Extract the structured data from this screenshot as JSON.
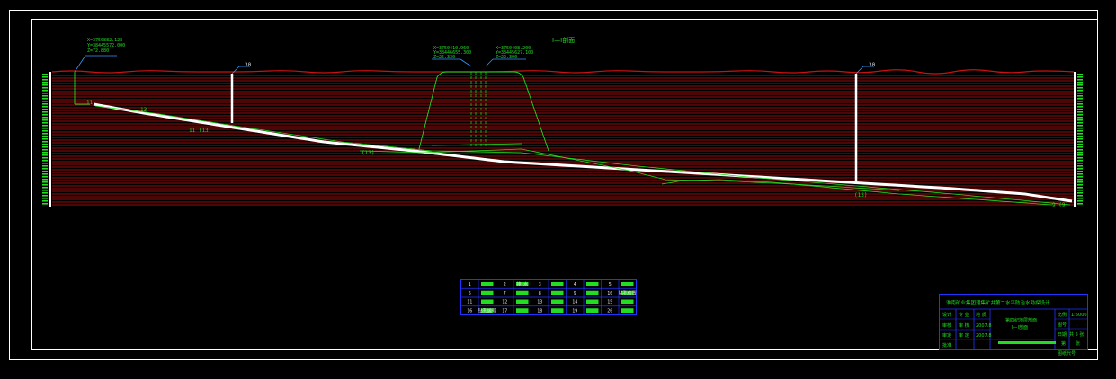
{
  "drawing": {
    "section_title": "I—I剖面",
    "markers": [
      {
        "label": "30"
      },
      {
        "label": "30"
      }
    ],
    "boreholes": [
      {
        "lines": [
          "X=3750882.128",
          "Y=38445572.000",
          "Z=72.880"
        ]
      },
      {
        "lines": [
          "X=3750410.960",
          "Y=38446655.300",
          "Z=25.330"
        ]
      },
      {
        "lines": [
          "X=3750408.200",
          "Y=38445627.100",
          "Z=22.300"
        ]
      }
    ],
    "seam_labels": [
      "11",
      "13",
      "11 (13)",
      "(13)",
      "(13)",
      "9 (9)"
    ],
    "colors": {
      "frame": "#ffffff",
      "strata": "#cc1111",
      "drawing": "#22dd22",
      "seam": "#ffffff",
      "table_border": "#2233ff"
    }
  },
  "legend_table": {
    "rows": [
      [
        "1",
        "",
        "2",
        "排 水",
        "3",
        "",
        "4",
        "",
        "5",
        ""
      ],
      [
        "6",
        "",
        "7",
        "",
        "8",
        "",
        "9",
        "",
        "10",
        "钻孔位置"
      ],
      [
        "11",
        "",
        "12",
        "",
        "13",
        "",
        "14",
        "",
        "15",
        ""
      ],
      [
        "16",
        "钻孔编号",
        "17",
        "",
        "18",
        "",
        "19",
        "",
        "20",
        ""
      ]
    ]
  },
  "title_block": {
    "header": "淮南矿业集团潘集矿井第二水平防治水勘探设计",
    "left_labels": [
      "设计",
      "审核",
      "审定",
      "批准"
    ],
    "roles": [
      "专 业",
      "审 核",
      "审 定"
    ],
    "names": [
      "地 质",
      "2007.8",
      "2007.8"
    ],
    "drawing_name": [
      "第四纪地层剖面",
      "I—I剖面"
    ],
    "right_labels": [
      "比例",
      "图号",
      "日期"
    ],
    "right_values": [
      "1:5000",
      "",
      "共 5 张"
    ],
    "page": [
      "第",
      "张"
    ],
    "footer": "图纸代号"
  }
}
